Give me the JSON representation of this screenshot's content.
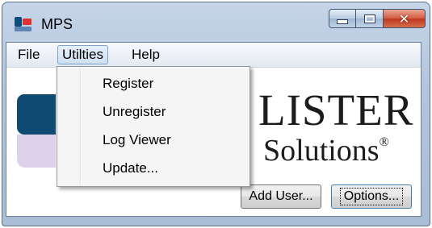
{
  "window": {
    "title": "MPS",
    "caption_buttons": [
      "minimize-icon",
      "maximize-icon",
      "close-icon"
    ]
  },
  "menubar": {
    "items": [
      {
        "label": "File"
      },
      {
        "label": "Utilties"
      },
      {
        "label": "Help"
      }
    ]
  },
  "dropdown": {
    "items": [
      {
        "label": "Register"
      },
      {
        "label": "Unregister"
      },
      {
        "label": "Log Viewer"
      },
      {
        "label": "Update..."
      }
    ]
  },
  "brand": {
    "line1": "LISTER",
    "line2": "Solutions",
    "mark": "®",
    "colors": {
      "dark_blue": "#0f4a73",
      "lavender": "#dcd3ea"
    }
  },
  "buttons": {
    "add_user": "Add User...",
    "options": "Options..."
  }
}
